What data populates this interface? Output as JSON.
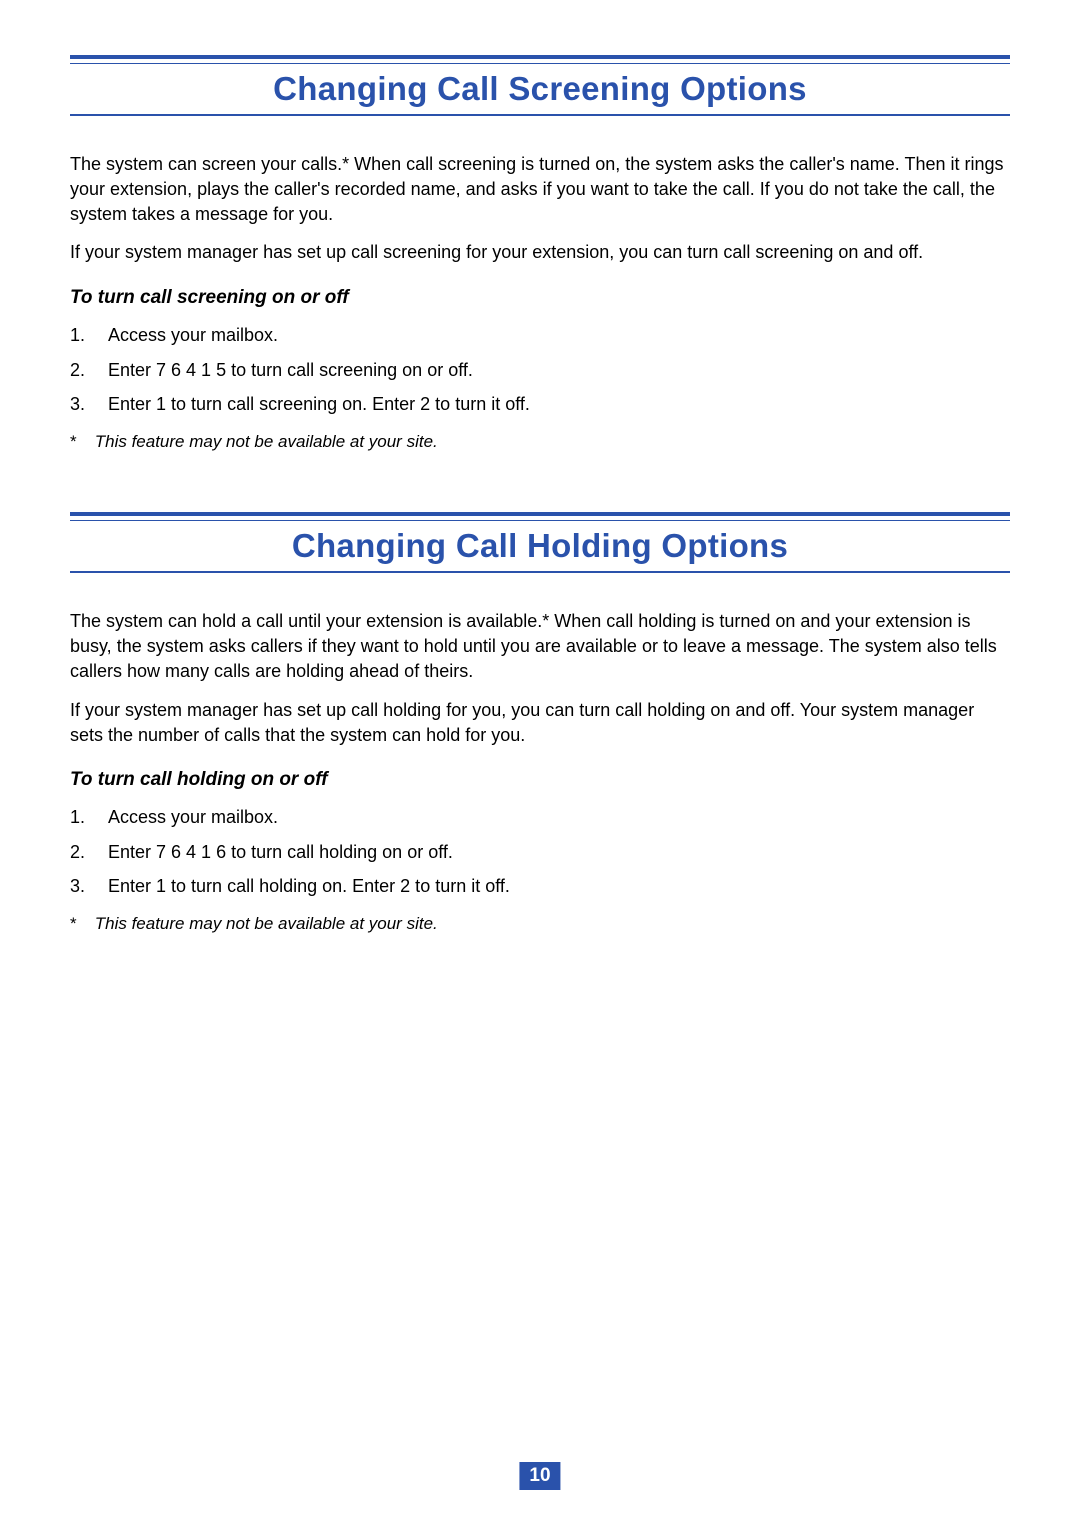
{
  "page_number": "10",
  "sections": [
    {
      "title": "Changing Call Screening Options",
      "paragraphs": [
        "The system can screen your calls.*  When call screening is turned on, the system asks the caller's name. Then it rings your extension, plays the caller's recorded name, and asks if you want to take the call. If you do not take the call, the system takes a message for you.",
        "If your system manager has set up call screening for your extension, you can turn call screening on and off."
      ],
      "subhead": "To turn call screening on or off",
      "steps": [
        "Access your mailbox.",
        "Enter 7 6 4 1 5 to turn call screening on or off.",
        "Enter 1 to turn call screening on. Enter 2 to turn it off."
      ],
      "footnote_marker": "*",
      "footnote": "This feature may not be available at your site."
    },
    {
      "title": "Changing Call Holding Options",
      "paragraphs": [
        "The system can hold a call until your extension is available.*  When call holding is turned on and your extension is busy, the system asks callers if they want to hold until you are available or to leave a message. The system also tells callers how many calls are holding ahead of theirs.",
        "If your system manager has set up call holding for you, you can turn call holding on and off. Your system manager sets the number of calls that the system can hold for you."
      ],
      "subhead": "To turn call holding on or off",
      "steps": [
        "Access your mailbox.",
        "Enter 7 6 4 1 6 to turn call holding on or off.",
        "Enter 1 to turn call holding on.  Enter 2 to turn it off."
      ],
      "footnote_marker": "*",
      "footnote": "This feature may not be available at your site."
    }
  ]
}
